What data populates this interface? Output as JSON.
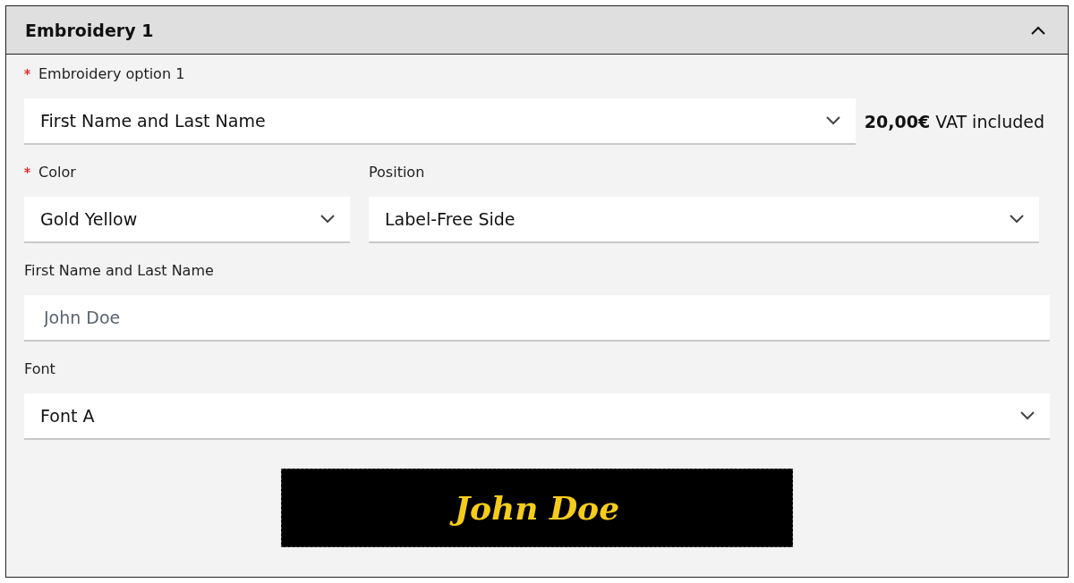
{
  "panel": {
    "title": "Embroidery 1",
    "expanded": true
  },
  "rows": [
    {
      "fields": [
        {
          "kind": "select",
          "label": "Embroidery option 1",
          "required": true,
          "value": "First Name and Last Name"
        }
      ],
      "price": "**20,00€** VAT included"
    },
    {
      "fields": [
        {
          "kind": "select",
          "label": "Color",
          "required": true,
          "value": "Gold Yellow"
        },
        {
          "kind": "select",
          "label": "Position",
          "required": false,
          "value": "Label-Free Side"
        }
      ]
    },
    {
      "fields": [
        {
          "kind": "text",
          "label": "First Name and Last Name",
          "required": false,
          "placeholder": "John Doe"
        }
      ]
    },
    {
      "fields": [
        {
          "kind": "select",
          "label": "Font",
          "required": false,
          "value": "Font A"
        }
      ]
    }
  ],
  "preview": {
    "text": "John Doe"
  }
}
